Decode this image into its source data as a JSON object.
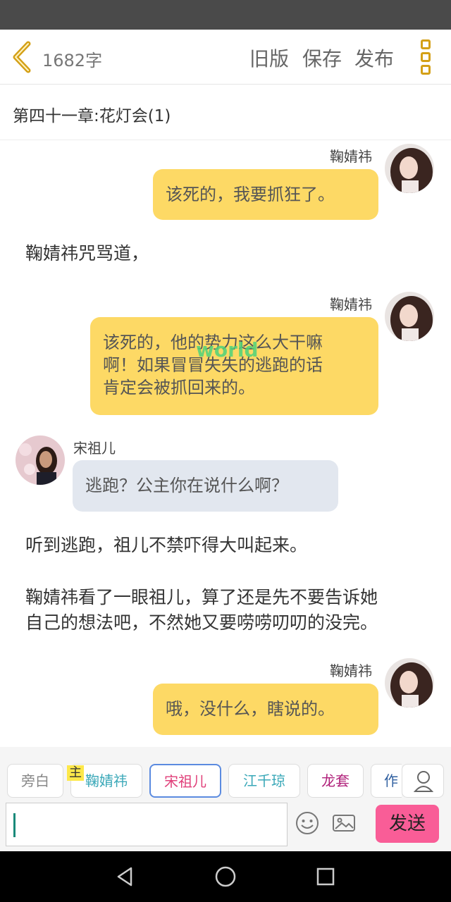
{
  "header": {
    "word_count": "1682字",
    "actions": [
      "旧版",
      "保存",
      "发布"
    ]
  },
  "chapter": {
    "title": "第四十一章:花灯会(1)"
  },
  "messages": [
    {
      "speaker": "鞠婧祎",
      "text": "该死的，我要抓狂了。"
    },
    {
      "narration": "鞠婧祎咒骂道，"
    },
    {
      "speaker": "鞠婧祎",
      "lines": [
        "该死的，他的势力这么大干嘛",
        "啊！如果冒冒失失的逃跑的话",
        "肯定会被抓回来的。"
      ]
    },
    {
      "speaker": "宋祖儿",
      "text": "逃跑？公主你在说什么啊？"
    },
    {
      "narration": "听到逃跑，祖儿不禁吓得大叫起来。"
    },
    {
      "narration_lines": [
        "鞠婧祎看了一眼祖儿，算了还是先不要告诉她",
        "自己的想法吧，不然她又要唠唠叨叨的没完。"
      ]
    },
    {
      "speaker": "鞠婧祎",
      "text": "哦，没什么，瞎说的。"
    }
  ],
  "watermark": "world",
  "characters": {
    "host_badge": "主",
    "chips": [
      {
        "label": "旁白",
        "color": "#888888"
      },
      {
        "label": "鞠婧祎",
        "color": "#3aa8b8"
      },
      {
        "label": "宋祖儿",
        "color": "#e0407a"
      },
      {
        "label": "江千琼",
        "color": "#3aa8b8"
      },
      {
        "label": "龙套",
        "color": "#b0207a"
      },
      {
        "label": "作",
        "color": "#3060a0"
      }
    ]
  },
  "input": {
    "value": "",
    "send_label": "发送"
  },
  "icons": {
    "back": "chevron-left-icon",
    "more": "more-vertical-icon",
    "person": "person-icon",
    "emoji": "emoji-icon",
    "image": "image-icon",
    "nav": [
      "back-triangle-icon",
      "home-circle-icon",
      "recents-square-icon"
    ]
  },
  "colors": {
    "accent": "#d4a017",
    "bubble_right": "#fdd965",
    "bubble_left": "#e2e7ef",
    "send": "#f95d97"
  }
}
